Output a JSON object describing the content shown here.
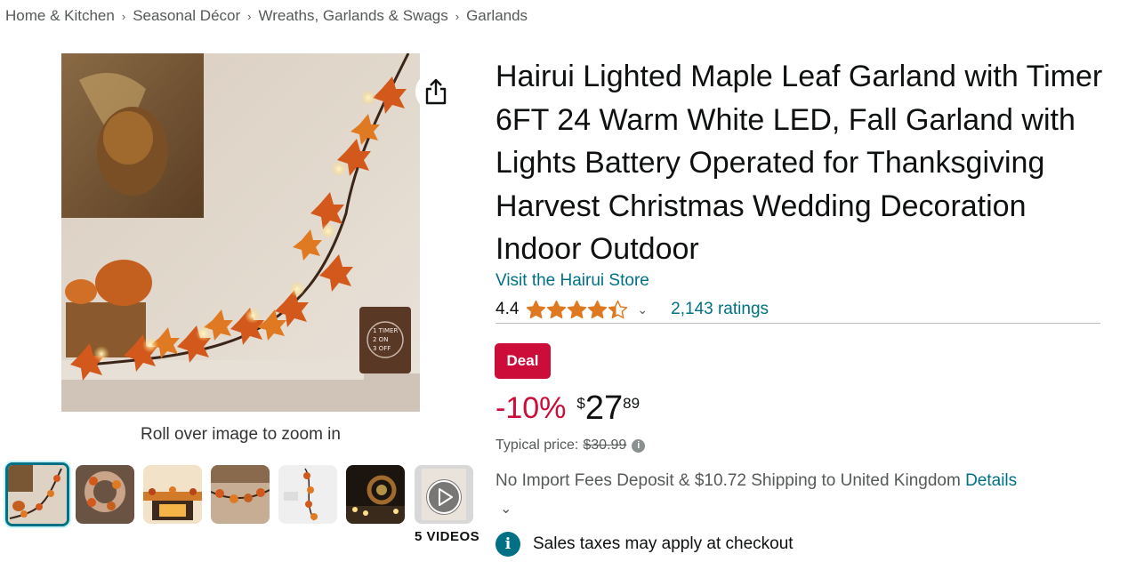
{
  "breadcrumb": {
    "items": [
      "Home & Kitchen",
      "Seasonal Décor",
      "Wreaths, Garlands & Swags",
      "Garlands"
    ],
    "separator": "›"
  },
  "gallery": {
    "zoom_hint": "Roll over image to zoom in",
    "videos_label": "5 VIDEOS",
    "main_image_overlay": {
      "line1": "1 TIMER",
      "line2": "2 ON",
      "line3": "3 OFF"
    },
    "thumbnail_count": 7,
    "selected_thumbnail": 0
  },
  "product": {
    "title": "Hairui Lighted Maple Leaf Garland with Timer 6FT 24 Warm White LED, Fall Garland with Lights Battery Operated for Thanksgiving Harvest Christmas Wedding Decoration Indoor Outdoor",
    "store_link": "Visit the Hairui Store",
    "rating": "4.4",
    "rating_value": 4.4,
    "ratings_count": "2,143 ratings",
    "deal_badge": "Deal",
    "discount": "-10%",
    "currency": "$",
    "price_whole": "27",
    "price_fraction": "89",
    "typical_label": "Typical price:",
    "typical_price": "$30.99",
    "shipping_text": "No Import Fees Deposit & $10.72 Shipping to United Kingdom",
    "shipping_details": "Details",
    "tax_text": "Sales taxes may apply at checkout"
  },
  "colors": {
    "link": "#007185",
    "deal": "#cc0c39",
    "star": "#de7921",
    "text": "#0f1111",
    "muted": "#565959"
  },
  "icons": {
    "share": "share-icon",
    "star": "star-icon",
    "chevron": "chevron-down-icon",
    "info": "info-icon",
    "play": "play-icon"
  }
}
